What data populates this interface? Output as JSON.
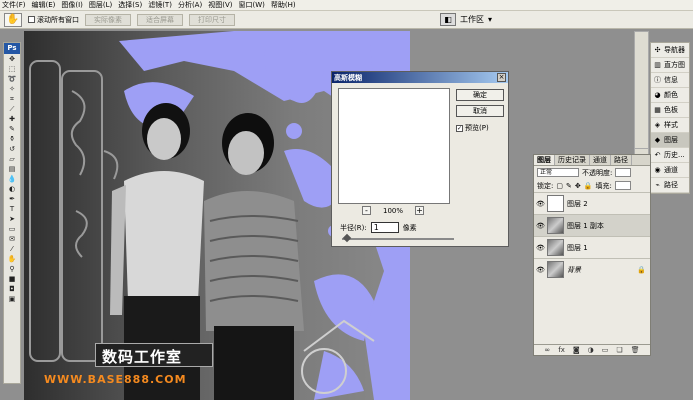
{
  "menubar": {
    "items": [
      "文件(F)",
      "编辑(E)",
      "图像(I)",
      "图层(L)",
      "选择(S)",
      "滤镜(T)",
      "分析(A)",
      "视图(V)",
      "窗口(W)",
      "帮助(H)"
    ]
  },
  "options": {
    "scroll_all": "滚动所有窗口",
    "buttons": [
      "实际像素",
      "适合屏幕",
      "打印尺寸"
    ],
    "workspace": "工作区"
  },
  "toolbox": {
    "brand": "Ps"
  },
  "right_panels": [
    {
      "label": "导航器",
      "icon": "navigator-icon"
    },
    {
      "label": "直方图",
      "icon": "histogram-icon"
    },
    {
      "label": "信息",
      "icon": "info-icon"
    },
    {
      "label": "颜色",
      "icon": "color-icon"
    },
    {
      "label": "色板",
      "icon": "swatches-icon"
    },
    {
      "label": "样式",
      "icon": "styles-icon"
    },
    {
      "label": "图层",
      "icon": "layers-icon"
    },
    {
      "label": "历史...",
      "icon": "history-icon"
    },
    {
      "label": "通道",
      "icon": "channels-icon"
    },
    {
      "label": "路径",
      "icon": "paths-icon"
    }
  ],
  "dialog": {
    "title": "高斯模糊",
    "ok": "确定",
    "cancel": "取消",
    "preview": "预览(P)",
    "zoom": "100%",
    "radius_label": "半径(R):",
    "radius_value": "1",
    "radius_unit": "像素"
  },
  "layers_panel": {
    "tabs": [
      "图层",
      "历史记录",
      "通道",
      "路径"
    ],
    "blend_mode": "正常",
    "opacity_label": "不透明度:",
    "lock_label": "锁定:",
    "fill_label": "填充:",
    "layers": [
      {
        "name": "图层 2",
        "selected": false
      },
      {
        "name": "图层 1 副本",
        "selected": true
      },
      {
        "name": "图层 1",
        "selected": false
      },
      {
        "name": "背景",
        "selected": false
      }
    ]
  },
  "watermark": {
    "text": "数码工作室",
    "url": "WWW.BASE888.COM"
  },
  "colors": {
    "mask": "#9e9ff5",
    "title_bar": "#0a246a",
    "watermark_url": "#f58a1f"
  }
}
